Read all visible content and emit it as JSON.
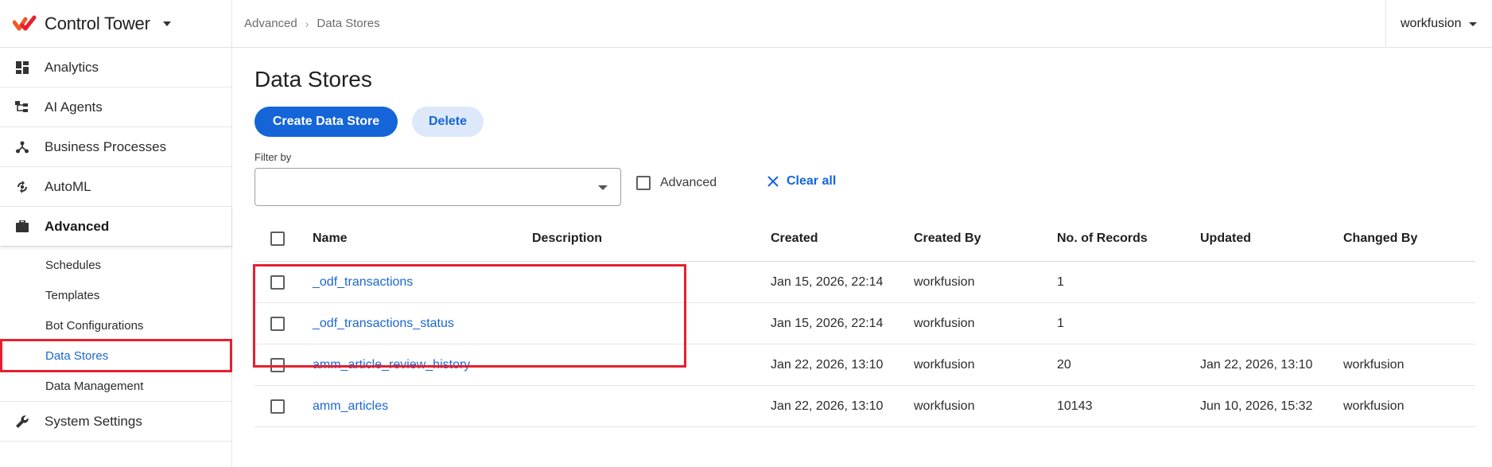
{
  "brand": {
    "name": "Control Tower"
  },
  "sidebar": {
    "items": [
      {
        "label": "Analytics",
        "icon": "dashboard-icon"
      },
      {
        "label": "AI Agents",
        "icon": "hierarchy-icon"
      },
      {
        "label": "Business Processes",
        "icon": "process-icon"
      },
      {
        "label": "AutoML",
        "icon": "automl-icon"
      },
      {
        "label": "Advanced",
        "icon": "briefcase-icon"
      }
    ],
    "subitems": [
      "Schedules",
      "Templates",
      "Bot Configurations",
      "Data Stores",
      "Data Management"
    ],
    "settings": {
      "label": "System Settings",
      "icon": "wrench-icon"
    }
  },
  "breadcrumb": {
    "parent": "Advanced",
    "current": "Data Stores"
  },
  "user": {
    "name": "workfusion"
  },
  "page": {
    "title": "Data Stores"
  },
  "actions": {
    "create": "Create Data Store",
    "delete": "Delete"
  },
  "filter": {
    "label": "Filter by",
    "value": "",
    "advanced_label": "Advanced",
    "clear_label": "Clear all"
  },
  "table": {
    "headers": {
      "name": "Name",
      "description": "Description",
      "created": "Created",
      "created_by": "Created By",
      "records": "No. of Records",
      "updated": "Updated",
      "changed_by": "Changed By"
    },
    "rows": [
      {
        "name": "_odf_transactions",
        "description": "",
        "created": "Jan 15, 2026, 22:14",
        "created_by": "workfusion",
        "records": "1",
        "updated": "",
        "changed_by": ""
      },
      {
        "name": "_odf_transactions_status",
        "description": "",
        "created": "Jan 15, 2026, 22:14",
        "created_by": "workfusion",
        "records": "1",
        "updated": "",
        "changed_by": ""
      },
      {
        "name": "amm_article_review_history",
        "description": "",
        "created": "Jan 22, 2026, 13:10",
        "created_by": "workfusion",
        "records": "20",
        "updated": "Jan 22, 2026, 13:10",
        "changed_by": "workfusion"
      },
      {
        "name": "amm_articles",
        "description": "",
        "created": "Jan 22, 2026, 13:10",
        "created_by": "workfusion",
        "records": "10143",
        "updated": "Jun 10, 2026, 15:32",
        "changed_by": "workfusion"
      }
    ]
  },
  "colors": {
    "accent": "#1565d8",
    "highlight": "#e5202e",
    "brand": "#f05a28"
  }
}
